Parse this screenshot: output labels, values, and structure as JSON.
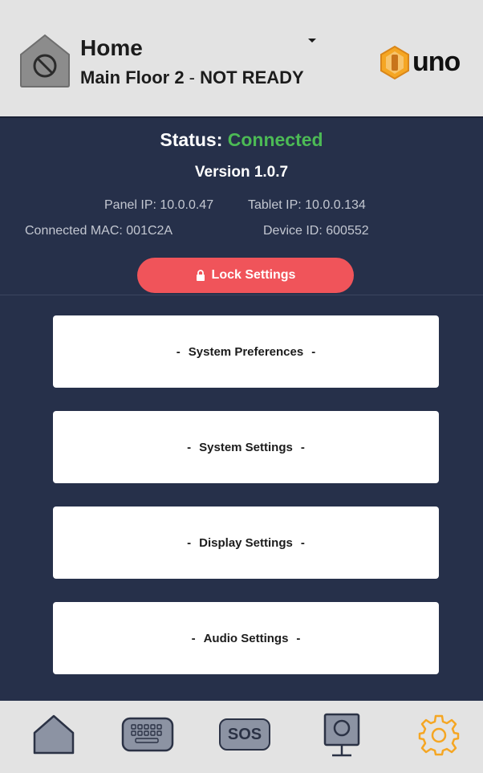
{
  "header": {
    "title": "Home",
    "subtitle_location": "Main Floor 2",
    "subtitle_separator": " - ",
    "subtitle_state": "NOT READY",
    "logo_text": "uno",
    "icons": {
      "status": "disarmed-home-icon",
      "dropdown": "caret-down-icon",
      "logo": "uno-logo-icon"
    }
  },
  "status": {
    "label": "Status:",
    "value": "Connected",
    "version": "Version 1.0.7",
    "panel_ip": "Panel IP: 10.0.0.47",
    "tablet_ip": "Tablet IP: 10.0.0.134",
    "connected_mac": "Connected MAC: 001C2A",
    "device_id": "Device ID: 600552",
    "lock_label": "Lock Settings"
  },
  "menu": {
    "items": [
      {
        "label": "System Preferences"
      },
      {
        "label": "System Settings"
      },
      {
        "label": "Display Settings"
      },
      {
        "label": "Audio Settings"
      }
    ],
    "dash": "-"
  },
  "bottom_nav": {
    "sos_label": "SOS",
    "items": [
      "home-icon",
      "keypad-icon",
      "sos-icon",
      "camera-icon",
      "settings-gear-icon"
    ],
    "active": "settings-gear-icon"
  },
  "colors": {
    "background": "#26304a",
    "header": "#e3e3e3",
    "connected": "#4cba55",
    "lock_button": "#f0545a",
    "active_nav": "#f5a623",
    "nav_icon": "#8c93a3"
  }
}
